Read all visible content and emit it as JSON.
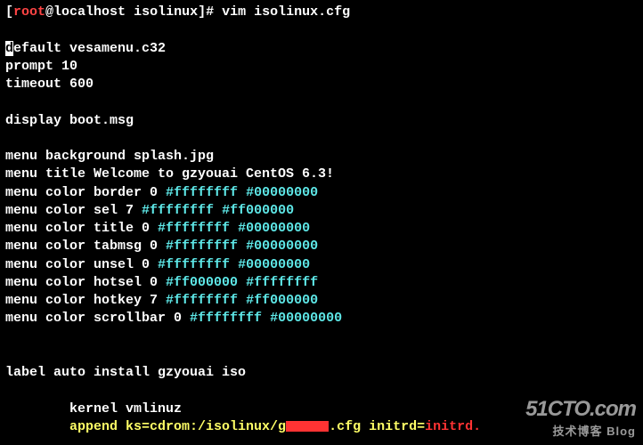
{
  "prompt": {
    "user": "root",
    "at": "@",
    "host": "localhost",
    "cwd": " isolinux",
    "hash": "#",
    "command": " vim isolinux.cfg"
  },
  "file": {
    "default_left": "d",
    "default_rest": "efault vesamenu.c32",
    "prompt_line": "prompt 10",
    "timeout_line": "timeout 600",
    "display_line": "display boot.msg",
    "menu_bg": "menu background splash.jpg",
    "menu_title": "menu title Welcome to gzyouai CentOS 6.3!",
    "menu_color_border": {
      "label": "menu color border 0 ",
      "v1": "#ffffffff",
      "sep": " ",
      "v2": "#00000000"
    },
    "menu_color_sel": {
      "label": "menu color sel 7 ",
      "v1": "#ffffffff",
      "sep": " ",
      "v2": "#ff000000"
    },
    "menu_color_title": {
      "label": "menu color title 0 ",
      "v1": "#ffffffff",
      "sep": " ",
      "v2": "#00000000"
    },
    "menu_color_tabmsg": {
      "label": "menu color tabmsg 0 ",
      "v1": "#ffffffff",
      "sep": " ",
      "v2": "#00000000"
    },
    "menu_color_unsel": {
      "label": "menu color unsel 0 ",
      "v1": "#ffffffff",
      "sep": " ",
      "v2": "#00000000"
    },
    "menu_color_hotsel": {
      "label": "menu color hotsel 0 ",
      "v1": "#ff000000",
      "sep": " ",
      "v2": "#ffffffff"
    },
    "menu_color_hotkey": {
      "label": "menu color hotkey 7 ",
      "v1": "#ffffffff",
      "sep": " ",
      "v2": "#ff000000"
    },
    "menu_color_scrollbar": {
      "label": "menu color scrollbar 0 ",
      "v1": "#ffffffff",
      "sep": " ",
      "v2": "#00000000"
    },
    "label_line": "label auto install gzyouai iso",
    "kernel_line": "        kernel vmlinuz",
    "append": {
      "prefix": "        append ks=cdrom:/isolinux/g",
      "suffix_cfg": ".cfg initrd=",
      "initrd": "initrd."
    }
  },
  "watermark": {
    "line1": "51CTO.com",
    "line2": "技术博客     Blog"
  }
}
